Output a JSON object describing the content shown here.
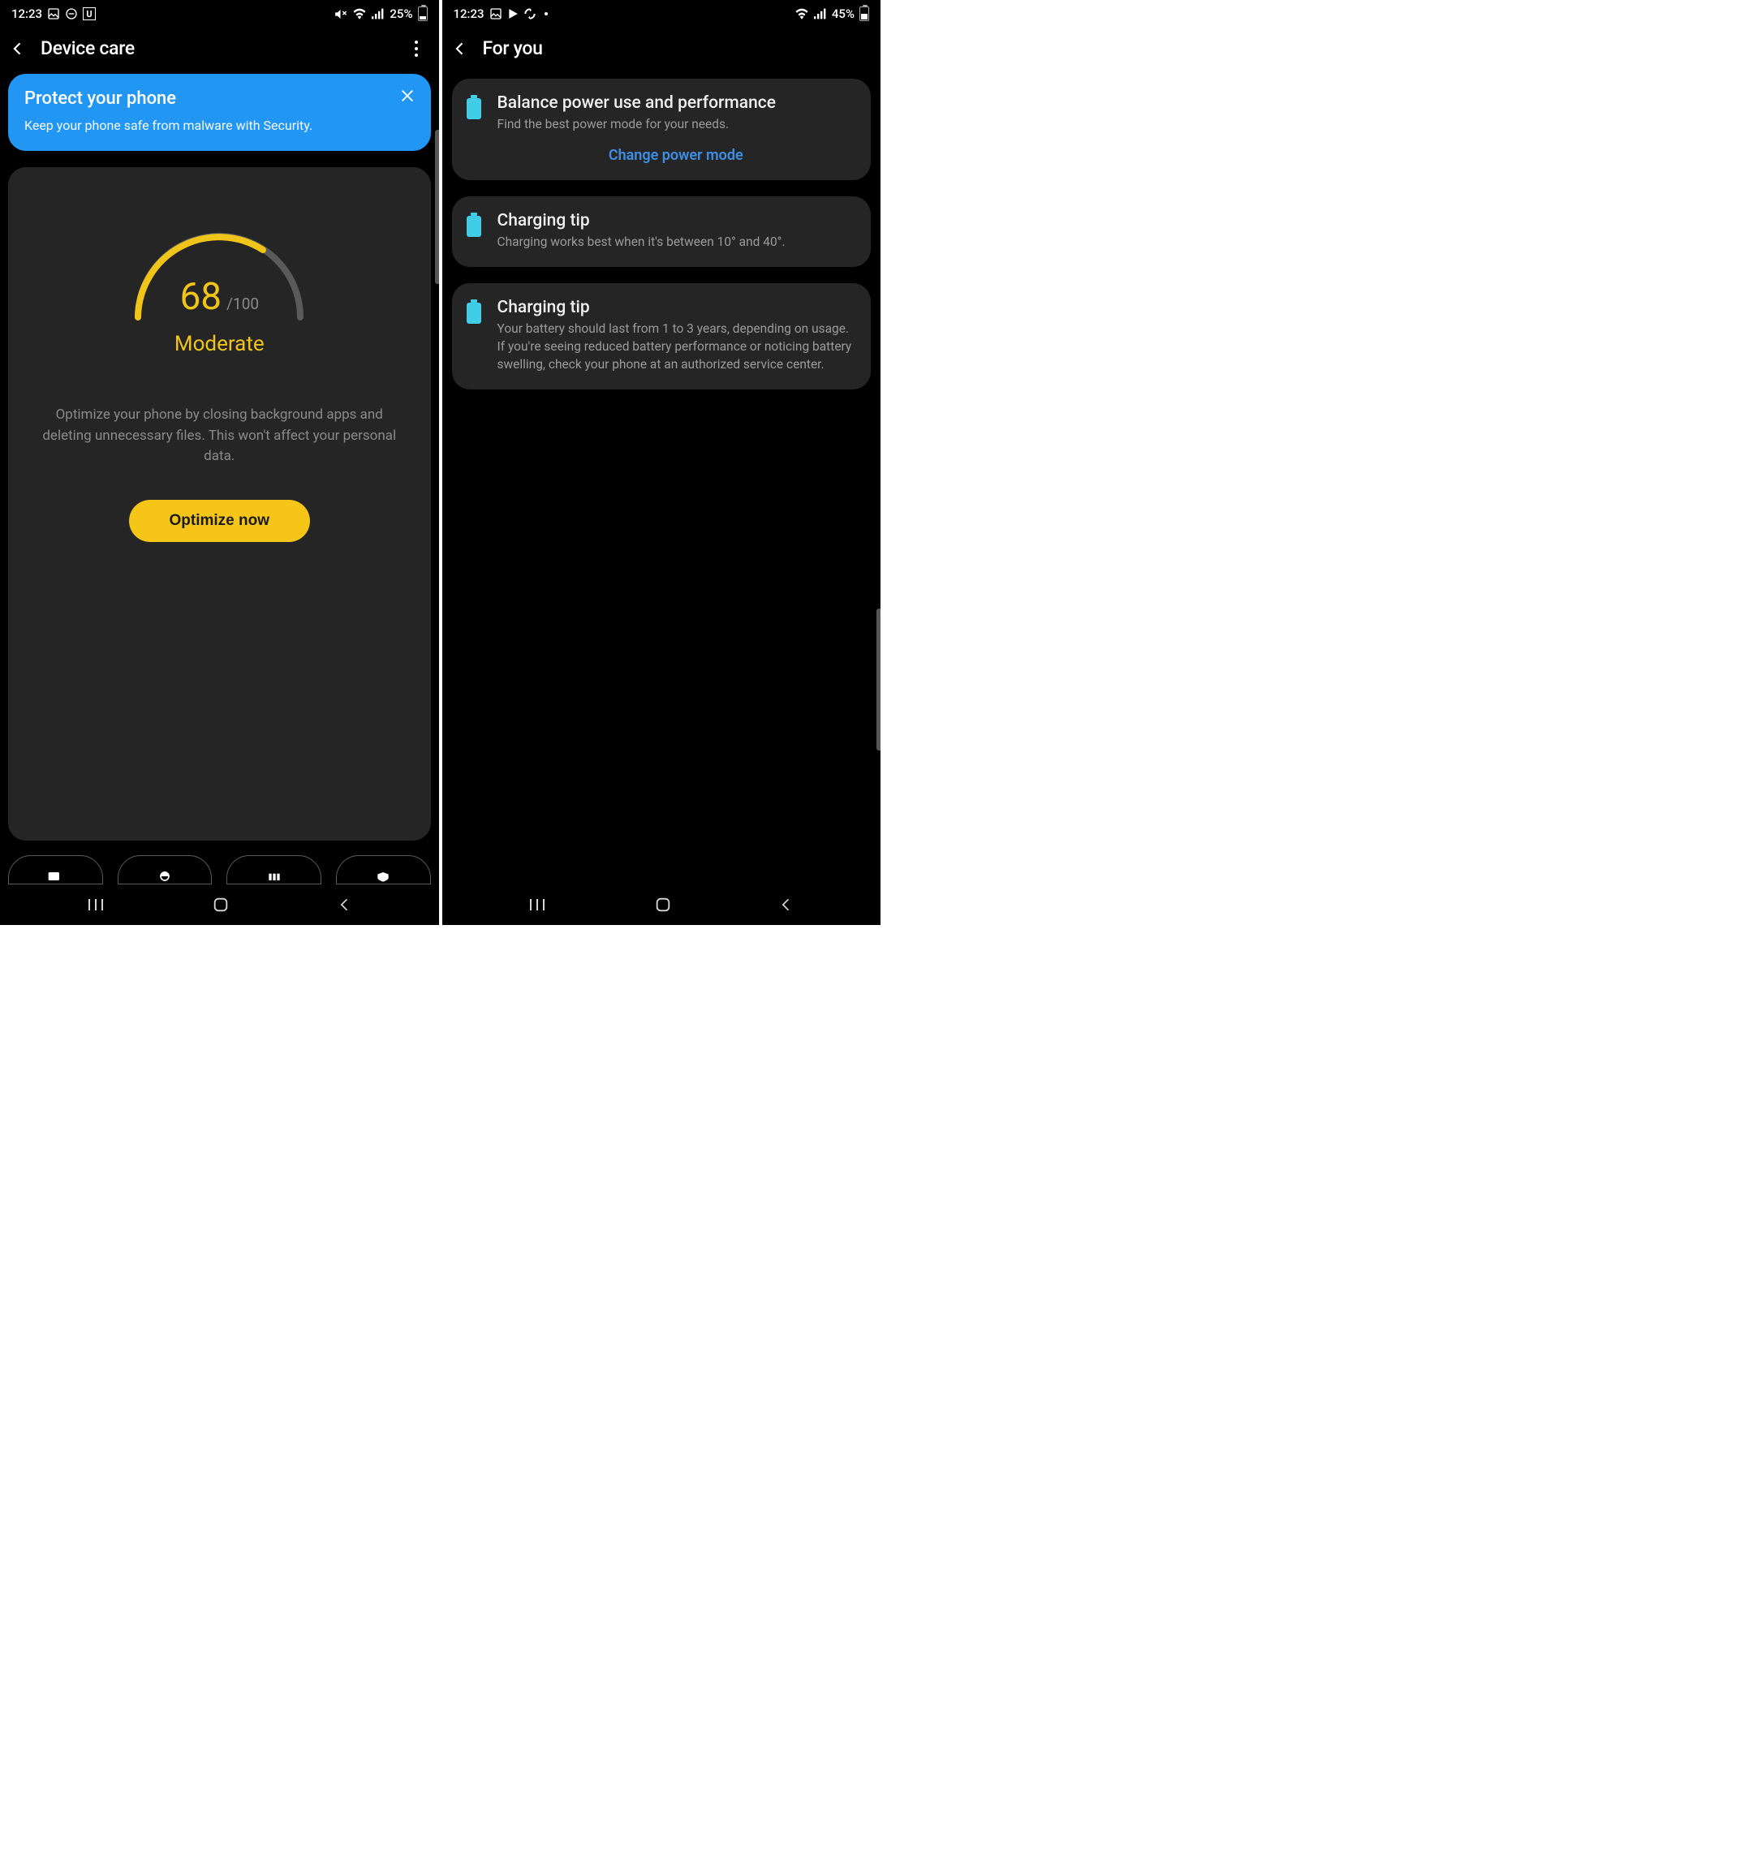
{
  "left": {
    "status": {
      "time": "12:23",
      "battery_pct": "25%",
      "battery_fill_pct": 25
    },
    "header": {
      "title": "Device care"
    },
    "protect": {
      "title": "Protect your phone",
      "desc": "Keep your phone safe from malware with Security."
    },
    "score": {
      "value": "68",
      "max": "/100",
      "label": "Moderate",
      "gauge_pct": 68,
      "desc": "Optimize your phone by closing background apps and deleting unnecessary files. This won't affect your personal data.",
      "button": "Optimize now"
    }
  },
  "right": {
    "status": {
      "time": "12:23",
      "battery_pct": "45%",
      "battery_fill_pct": 45
    },
    "header": {
      "title": "For you"
    },
    "cards": [
      {
        "title": "Balance power use and performance",
        "desc": "Find the best power mode for your needs.",
        "action": "Change power mode"
      },
      {
        "title": "Charging tip",
        "desc": "Charging works best when it's between 10° and 40°."
      },
      {
        "title": "Charging tip",
        "desc": "Your battery should last from 1 to 3 years, depending on usage. If you're seeing reduced battery performance or noticing battery swelling, check your phone at an authorized service center."
      }
    ]
  }
}
